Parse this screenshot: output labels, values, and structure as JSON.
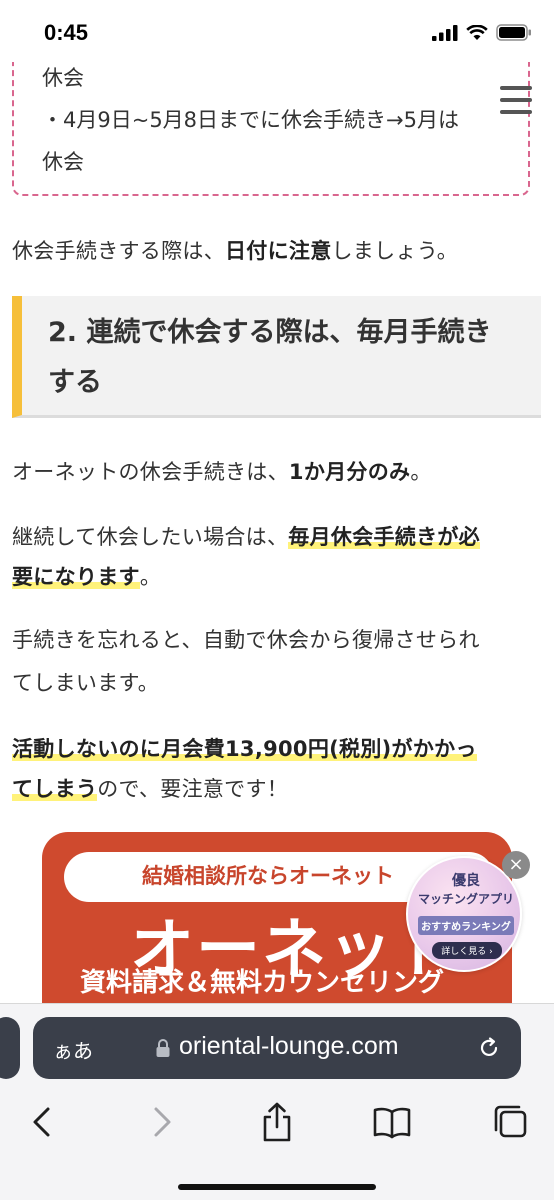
{
  "status_bar": {
    "time": "0:45"
  },
  "article": {
    "notice": {
      "line1": "休会",
      "line2": "・4月9日~5月8日までに休会手続き→5月は",
      "line3": "休会"
    },
    "p1": {
      "text1": "休会手続きする際は、",
      "bold": "日付に注意",
      "text2": "しましょう。"
    },
    "heading": {
      "line1": "2. 連続で休会する際は、毎月手続き",
      "line2": "する"
    },
    "p2": {
      "text1": "オーネットの休会手続きは、",
      "bold": "1か月分のみ",
      "text2": "。"
    },
    "p3": {
      "text1": "継続して休会したい場合は、",
      "hl1": "毎月休会手続きが必",
      "hl2": "要になります",
      "text2": "。"
    },
    "p4": {
      "line1": "手続きを忘れると、自動で休会から復帰させられ",
      "line2": "てしまいます。"
    },
    "p5": {
      "hl1": "活動しないのに月会費13,900円(税別)がかかっ",
      "hl2": "てしまう",
      "text2": "ので、要注意です！"
    }
  },
  "banner": {
    "pill_text": "結婚相談所ならオーネット",
    "title": "オーネット",
    "subtitle": "資料請求＆無料カウンセリング"
  },
  "ranking_badge": {
    "line1": "優良",
    "line2": "マッチングアプリ",
    "line3": "おすすめランキング",
    "line4": "詳しく見る ›",
    "close": "×"
  },
  "safari": {
    "aa_label": "ぁあ",
    "url": "oriental-lounge.com"
  },
  "colors": {
    "heading_accent": "#f6bf3a",
    "notice_border": "#d9668e",
    "banner_red": "#cf4a2e",
    "highlight": "#fff27a"
  }
}
